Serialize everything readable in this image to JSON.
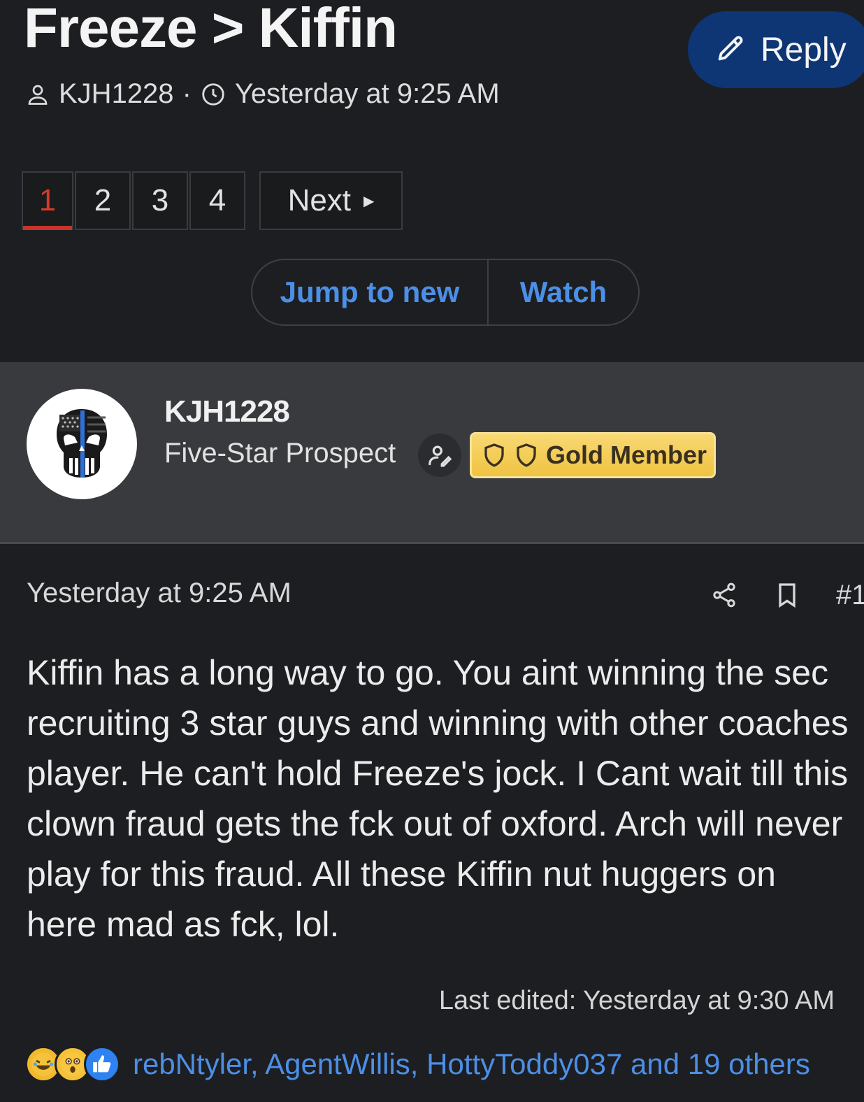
{
  "thread": {
    "title": "Freeze > Kiffin",
    "reply_label": "Reply",
    "author": "KJH1228",
    "separator": "·",
    "created": "Yesterday at 9:25 AM"
  },
  "pagination": {
    "pages": [
      "1",
      "2",
      "3",
      "4"
    ],
    "current": "1",
    "next_label": "Next"
  },
  "actions": {
    "jump_label": "Jump to new",
    "watch_label": "Watch"
  },
  "user": {
    "name": "KJH1228",
    "title": "Five-Star Prospect",
    "badge": "Gold Member"
  },
  "post": {
    "date": "Yesterday at 9:25 AM",
    "number": "#1",
    "body": "Kiffin has a long way to go. You aint winning the sec recruiting 3 star guys and winning with other coaches player. He can't hold Freeze's jock. I Cant wait till this clown fraud gets the fck out of oxford. Arch will never play for this fraud. All these Kiffin nut huggers on here mad as fck, lol.",
    "last_edited": "Last edited: Yesterday at 9:30 AM",
    "reactions": {
      "icons": [
        "laugh-reaction-icon",
        "wow-reaction-icon",
        "like-reaction-icon"
      ],
      "text": "rebNtyler, AgentWillis, HottyToddy037 and 19 others"
    }
  },
  "colors": {
    "background": "#1d1e21",
    "user_block": "#393a3e",
    "reply_button": "#0e3574",
    "link_blue": "#4c8fe6",
    "current_page": "#d53b2b",
    "gold_badge": "#f0c341"
  }
}
